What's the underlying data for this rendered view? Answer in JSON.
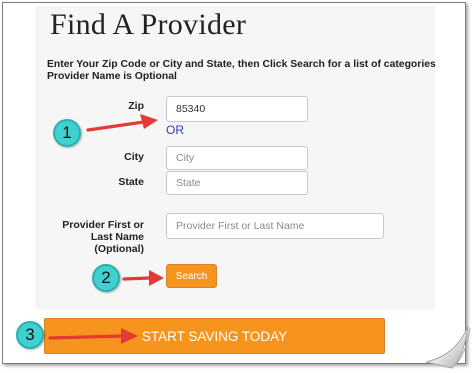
{
  "heading": "Find A Provider",
  "instructions": {
    "line1": "Enter Your Zip Code or City and State, then Click Search for a list of categories",
    "line2": "Provider Name is Optional"
  },
  "form": {
    "zip_label": "Zip",
    "zip_value": "85340",
    "or_text": "OR",
    "city_label": "City",
    "city_placeholder": "City",
    "state_label": "State",
    "state_placeholder": "State",
    "provider_label_line1": "Provider First or",
    "provider_label_line2": "Last Name",
    "provider_label_line3": "(Optional)",
    "provider_placeholder": "Provider First or Last Name",
    "search_label": "Search"
  },
  "cta": {
    "label": "START SAVING TODAY"
  },
  "callouts": {
    "step1": "1",
    "step2": "2",
    "step3": "3"
  },
  "colors": {
    "accent_orange": "#f7941d",
    "or_blue": "#2b3fae",
    "badge_teal": "#3fd0cf",
    "arrow_red": "#e53935"
  },
  "icons": {
    "arrows": "red-arrow-icon",
    "page_curl": "page-curl-icon"
  }
}
